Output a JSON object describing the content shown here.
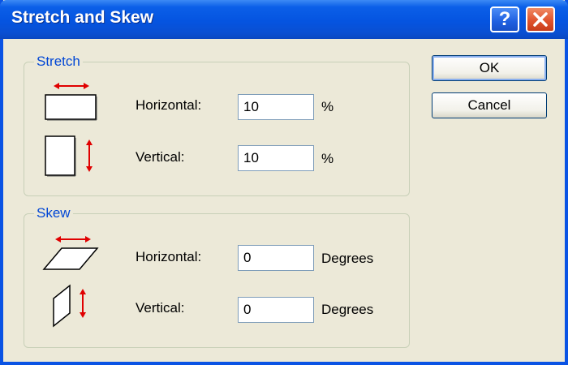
{
  "window": {
    "title": "Stretch and Skew",
    "help_glyph": "?"
  },
  "stretch": {
    "legend": "Stretch",
    "horizontal": {
      "label": "Horizontal:",
      "value": "10",
      "unit": "%"
    },
    "vertical": {
      "label": "Vertical:",
      "value": "10",
      "unit": "%"
    }
  },
  "skew": {
    "legend": "Skew",
    "horizontal": {
      "label": "Horizontal:",
      "value": "0",
      "unit": "Degrees"
    },
    "vertical": {
      "label": "Vertical:",
      "value": "0",
      "unit": "Degrees"
    }
  },
  "buttons": {
    "ok": "OK",
    "cancel": "Cancel"
  },
  "colors": {
    "title_bar": "#0554e0",
    "legend_text": "#0046d5",
    "arrow": "#e00000",
    "close_button": "#e0532d"
  },
  "icons": {
    "stretch_horizontal": "stretch-horizontal-icon",
    "stretch_vertical": "stretch-vertical-icon",
    "skew_horizontal": "skew-horizontal-icon",
    "skew_vertical": "skew-vertical-icon"
  }
}
